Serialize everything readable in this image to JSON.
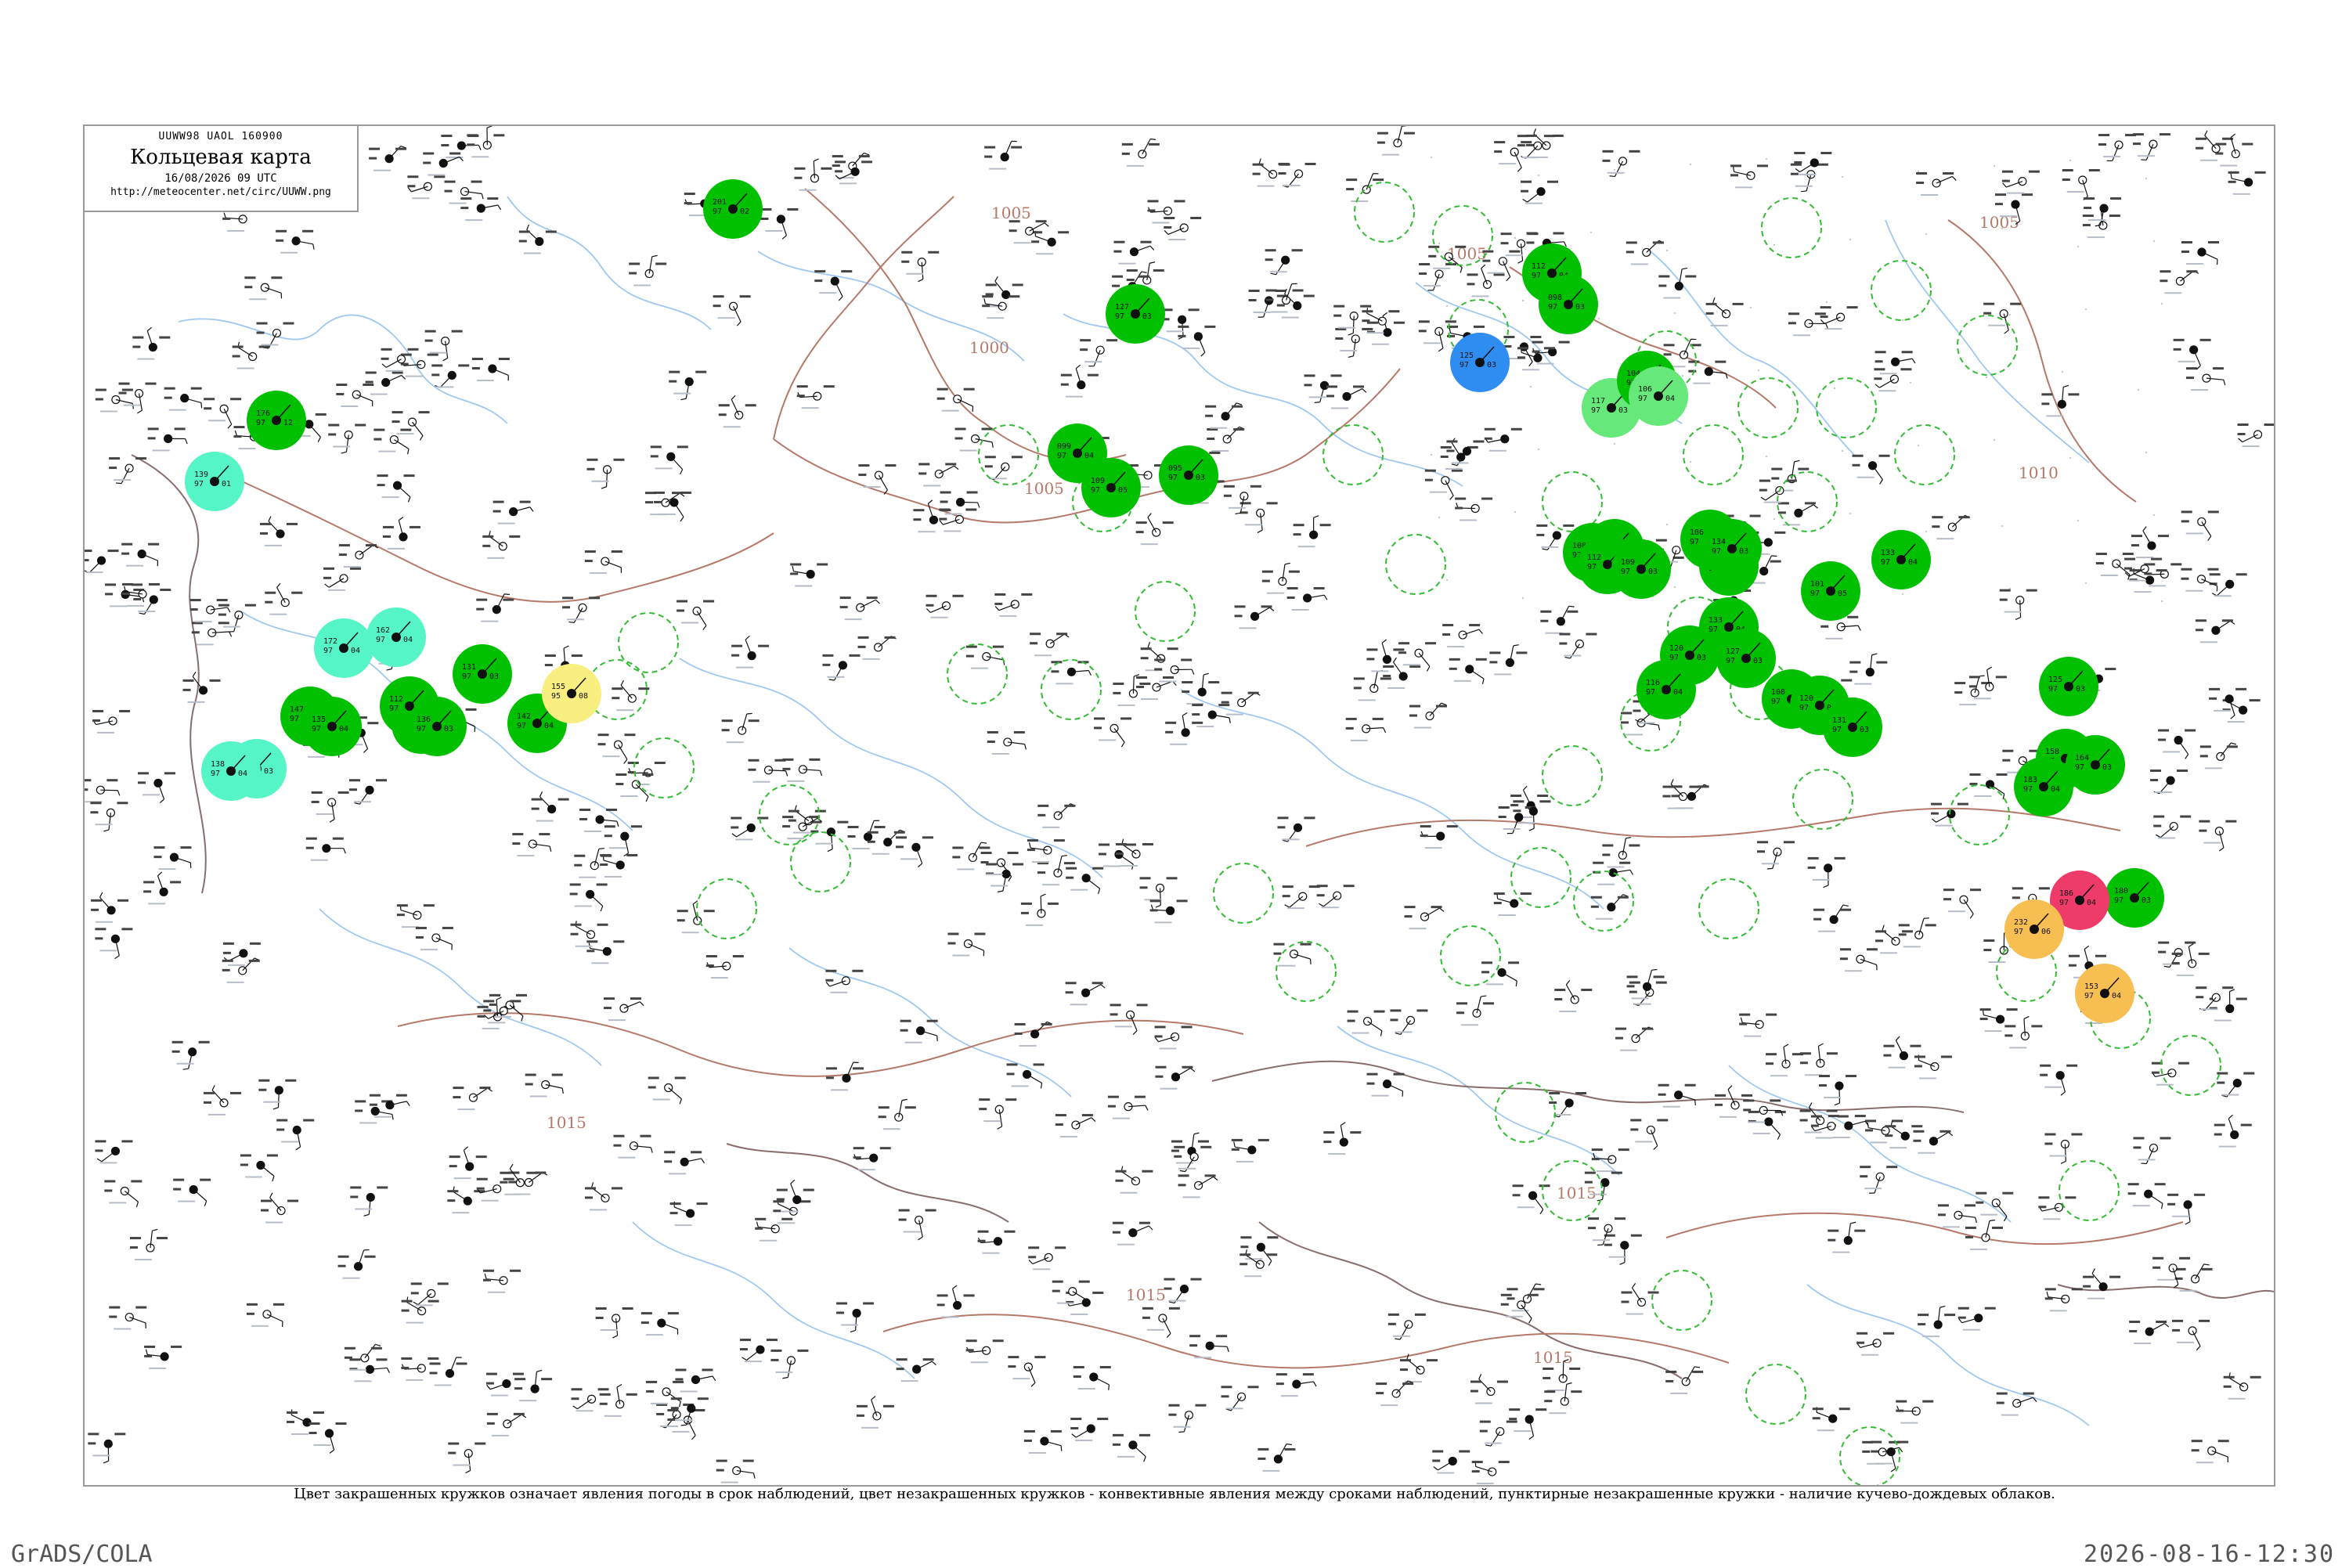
{
  "header": {
    "code": "UUWW98  UAOL  160900",
    "title": "Кольцевая карта",
    "date": "16/08/2026 09 UTC",
    "url": "http://meteocenter.net/circ/UUWW.png"
  },
  "caption": "Цвет закрашенных кружков означает явления погоды в срок наблюдений, цвет незакрашенных кружков - конвективные явления между сроками наблюдений, пунктирные незакрашенные кружки - наличие кучево-дождевых облаков.",
  "footer": {
    "left": "GrADS/COLA",
    "right": "2026-08-16-12:30"
  },
  "colors": {
    "rain": "#00c000",
    "drizzle": "#55f5c8",
    "light_rain": "#66e87a",
    "shower_blue": "#2f8cf0",
    "haze": "#f8ef80",
    "dust": "#f7be52",
    "thunder": "#ee3b6a",
    "cb_ring": "#33bb33",
    "river": "#9fc8f0",
    "isobar": "#b5796a",
    "border": "#8a6d6d"
  },
  "isobar_labels": [
    {
      "text": "1005"
    },
    {
      "text": "1000"
    },
    {
      "text": "1005"
    },
    {
      "text": "1010"
    },
    {
      "text": "1015"
    },
    {
      "text": "1015"
    },
    {
      "text": "1015"
    },
    {
      "text": "1015"
    },
    {
      "text": "1005"
    },
    {
      "text": "1005"
    },
    {
      "text": "1010"
    }
  ],
  "stations": [
    {
      "pressure": "176",
      "temp": "97",
      "dew": "12",
      "phen": "rain"
    },
    {
      "pressure": "139",
      "temp": "97",
      "dew": "01",
      "phen": "drizzle"
    },
    {
      "pressure": "162",
      "temp": "97",
      "dew": "04",
      "phen": "drizzle"
    },
    {
      "pressure": "172",
      "temp": "97",
      "dew": "04",
      "phen": "drizzle"
    },
    {
      "pressure": "141",
      "temp": "97",
      "dew": "03",
      "phen": "drizzle"
    },
    {
      "pressure": "138",
      "temp": "97",
      "dew": "04",
      "phen": "drizzle"
    },
    {
      "pressure": "147",
      "temp": "97",
      "dew": "02",
      "phen": "rain"
    },
    {
      "pressure": "135",
      "temp": "97",
      "dew": "04",
      "phen": "rain"
    },
    {
      "pressure": "144",
      "temp": "97",
      "dew": "03",
      "phen": "rain"
    },
    {
      "pressure": "112",
      "temp": "97",
      "dew": "04",
      "phen": "rain"
    },
    {
      "pressure": "136",
      "temp": "97",
      "dew": "03",
      "phen": "rain"
    },
    {
      "pressure": "131",
      "temp": "97",
      "dew": "03",
      "phen": "rain"
    },
    {
      "pressure": "142",
      "temp": "97",
      "dew": "04",
      "phen": "rain"
    },
    {
      "pressure": "155",
      "temp": "95",
      "dew": "08",
      "phen": "haze"
    },
    {
      "pressure": "201",
      "temp": "97",
      "dew": "02",
      "phen": "rain"
    },
    {
      "pressure": "127",
      "temp": "97",
      "dew": "03",
      "phen": "rain"
    },
    {
      "pressure": "099",
      "temp": "97",
      "dew": "04",
      "phen": "rain"
    },
    {
      "pressure": "109",
      "temp": "97",
      "dew": "05",
      "phen": "rain"
    },
    {
      "pressure": "095",
      "temp": "97",
      "dew": "03",
      "phen": "rain"
    },
    {
      "pressure": "125",
      "temp": "97",
      "dew": "03",
      "phen": "shower_blue"
    },
    {
      "pressure": "112",
      "temp": "97",
      "dew": "04",
      "phen": "rain"
    },
    {
      "pressure": "098",
      "temp": "97",
      "dew": "03",
      "phen": "rain"
    },
    {
      "pressure": "117",
      "temp": "97",
      "dew": "03",
      "phen": "light_rain"
    },
    {
      "pressure": "104",
      "temp": "97",
      "dew": "04",
      "phen": "rain"
    },
    {
      "pressure": "106",
      "temp": "97",
      "dew": "04",
      "phen": "light_rain"
    },
    {
      "pressure": "108",
      "temp": "97",
      "dew": "03",
      "phen": "rain"
    },
    {
      "pressure": "098",
      "temp": "97",
      "dew": "05",
      "phen": "rain"
    },
    {
      "pressure": "112",
      "temp": "97",
      "dew": "04",
      "phen": "rain"
    },
    {
      "pressure": "109",
      "temp": "97",
      "dew": "03",
      "phen": "rain"
    },
    {
      "pressure": "103",
      "temp": "97",
      "dew": "04",
      "phen": "rain"
    },
    {
      "pressure": "106",
      "temp": "97",
      "dew": "05",
      "phen": "rain"
    },
    {
      "pressure": "134",
      "temp": "97",
      "dew": "03",
      "phen": "rain"
    },
    {
      "pressure": "133",
      "temp": "97",
      "dew": "04",
      "phen": "rain"
    },
    {
      "pressure": "127",
      "temp": "97",
      "dew": "03",
      "phen": "rain"
    },
    {
      "pressure": "120",
      "temp": "97",
      "dew": "03",
      "phen": "rain"
    },
    {
      "pressure": "116",
      "temp": "97",
      "dew": "04",
      "phen": "rain"
    },
    {
      "pressure": "108",
      "temp": "97",
      "dew": "03",
      "phen": "rain"
    },
    {
      "pressure": "120",
      "temp": "97",
      "dew": "04",
      "phen": "rain"
    },
    {
      "pressure": "131",
      "temp": "97",
      "dew": "03",
      "phen": "rain"
    },
    {
      "pressure": "101",
      "temp": "97",
      "dew": "05",
      "phen": "rain"
    },
    {
      "pressure": "133",
      "temp": "97",
      "dew": "04",
      "phen": "rain"
    },
    {
      "pressure": "125",
      "temp": "97",
      "dew": "03",
      "phen": "rain"
    },
    {
      "pressure": "158",
      "temp": "97",
      "dew": "04",
      "phen": "rain"
    },
    {
      "pressure": "164",
      "temp": "97",
      "dew": "03",
      "phen": "rain"
    },
    {
      "pressure": "183",
      "temp": "97",
      "dew": "04",
      "phen": "rain"
    },
    {
      "pressure": "180",
      "temp": "97",
      "dew": "03",
      "phen": "rain"
    },
    {
      "pressure": "186",
      "temp": "97",
      "dew": "04",
      "phen": "thunder"
    },
    {
      "pressure": "153",
      "temp": "97",
      "dew": "04",
      "phen": "dust"
    },
    {
      "pressure": "232",
      "temp": "97",
      "dew": "06",
      "phen": "dust"
    }
  ]
}
